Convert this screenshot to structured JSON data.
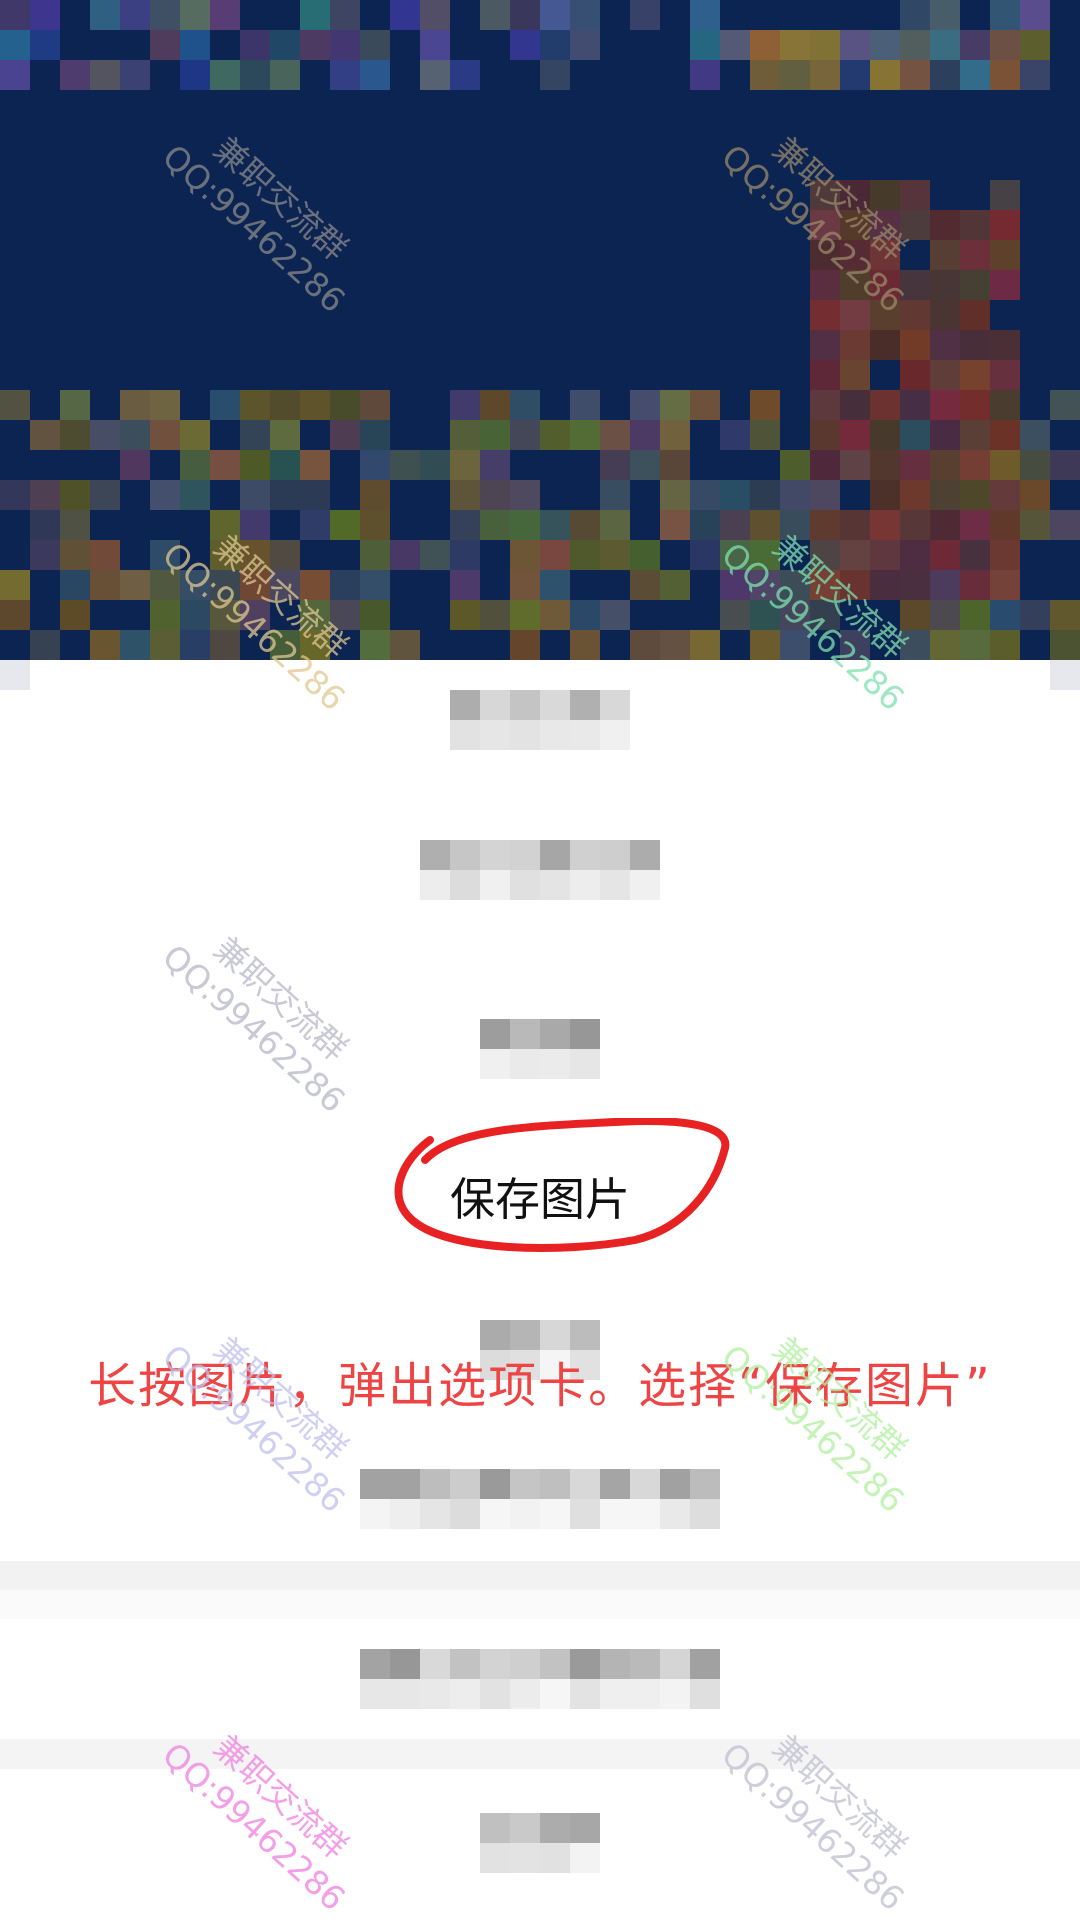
{
  "photo": {
    "description_hidden": false,
    "blurred": true
  },
  "action_sheet": {
    "options": [
      "",
      "",
      "",
      "保存图片",
      "",
      "",
      "",
      ""
    ],
    "highlighted": "保存图片"
  },
  "instruction": "长按图片，弹出选项卡。选择“保存图片”",
  "watermark": {
    "line1": "兼职交流群",
    "line2": "QQ:99462286"
  },
  "colors": {
    "annotation": "#e82222",
    "instruction_text": "#ee4444",
    "photo_bg": "#0c2452"
  }
}
